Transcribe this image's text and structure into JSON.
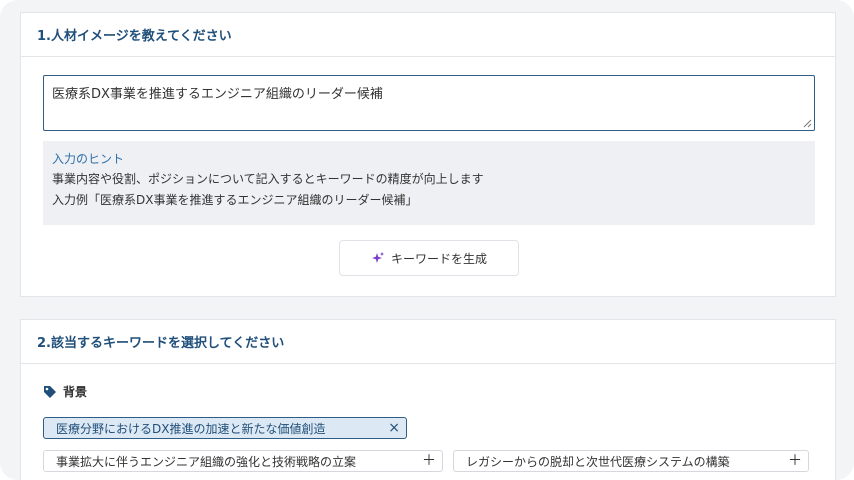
{
  "section1": {
    "title": "1.人材イメージを教えてください",
    "textarea_value": "医療系DX事業を推進するエンジニア組織のリーダー候補",
    "hint": {
      "title": "入力のヒント",
      "line1": "事業内容や役割、ポジションについて記入するとキーワードの精度が向上します",
      "line2": "入力例「医療系DX事業を推進するエンジニア組織のリーダー候補」"
    },
    "generate_button": {
      "label": "キーワードを生成",
      "icon": "sparkle-icon"
    }
  },
  "section2": {
    "title": "2.該当するキーワードを選択してください",
    "category": {
      "label": "背景",
      "icon": "tag-icon"
    },
    "chips": [
      {
        "label": "医療分野におけるDX推進の加速と新たな価値創造",
        "selected": true,
        "icon": "×"
      },
      {
        "label": "事業拡大に伴うエンジニア組織の強化と技術戦略の立案",
        "selected": false,
        "icon": "＋"
      },
      {
        "label": "レガシーからの脱却と次世代医療システムの構築",
        "selected": false,
        "icon": "＋"
      }
    ]
  },
  "colors": {
    "accent": "#1f4f7a",
    "hint_title": "#2f6fa8",
    "sparkle": "#7a3fc8",
    "tag": "#1f4f7a"
  }
}
